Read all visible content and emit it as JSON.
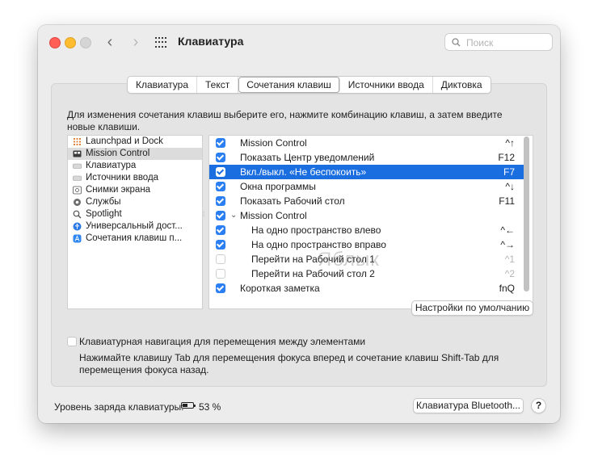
{
  "window": {
    "title": "Клавиатура"
  },
  "search": {
    "placeholder": "Поиск"
  },
  "tabs": [
    {
      "label": "Клавиатура"
    },
    {
      "label": "Текст"
    },
    {
      "label": "Сочетания клавиш",
      "active": true
    },
    {
      "label": "Источники ввода"
    },
    {
      "label": "Диктовка"
    }
  ],
  "instructions": "Для изменения сочетания клавиш выберите его, нажмите комбинацию клавиш, а затем введите новые клавиши.",
  "categories": [
    {
      "label": "Launchpad и Dock",
      "icon": "launchpad-icon"
    },
    {
      "label": "Mission Control",
      "icon": "mission-control-icon",
      "selected": true
    },
    {
      "label": "Клавиатура",
      "icon": "keyboard-icon"
    },
    {
      "label": "Источники ввода",
      "icon": "input-sources-icon"
    },
    {
      "label": "Снимки экрана",
      "icon": "screenshot-icon"
    },
    {
      "label": "Службы",
      "icon": "services-icon"
    },
    {
      "label": "Spotlight",
      "icon": "spotlight-icon"
    },
    {
      "label": "Универсальный дост...",
      "icon": "accessibility-icon"
    },
    {
      "label": "Сочетания клавиш п...",
      "icon": "app-shortcuts-icon"
    }
  ],
  "shortcuts": [
    {
      "label": "Mission Control",
      "key": "^↑",
      "checked": true
    },
    {
      "label": "Показать Центр уведомлений",
      "key": "F12",
      "checked": true
    },
    {
      "label": "Вкл./выкл. «Не беспокоить»",
      "key": "F7",
      "checked": true,
      "selected": true
    },
    {
      "label": "Окна программы",
      "key": "^↓",
      "checked": true
    },
    {
      "label": "Показать Рабочий стол",
      "key": "F11",
      "checked": true
    },
    {
      "label": "Mission Control",
      "key": "",
      "checked": true,
      "group": true
    },
    {
      "label": "На одно пространство влево",
      "key": "^←",
      "checked": true,
      "indent": true
    },
    {
      "label": "На одно пространство вправо",
      "key": "^→",
      "checked": true,
      "indent": true
    },
    {
      "label": "Перейти на Рабочий стол 1",
      "key": "^1",
      "checked": false,
      "indent": true
    },
    {
      "label": "Перейти на Рабочий стол 2",
      "key": "^2",
      "checked": false,
      "indent": true
    },
    {
      "label": "Короткая заметка",
      "key": "fnQ",
      "checked": true
    }
  ],
  "restore_defaults": "Настройки по умолчанию",
  "full_keyboard": {
    "label": "Клавиатурная навигация для перемещения между элементами",
    "description": "Нажимайте клавишу Tab для перемещения фокуса вперед и сочетание клавиш Shift-Tab для перемещения фокуса назад.",
    "checked": false
  },
  "battery": {
    "label": "Уровень заряда клавиатуры:",
    "percent": "53 %"
  },
  "bluetooth_button": "Клавиатура Bluetooth...",
  "help": "?",
  "watermark": "Яблык"
}
